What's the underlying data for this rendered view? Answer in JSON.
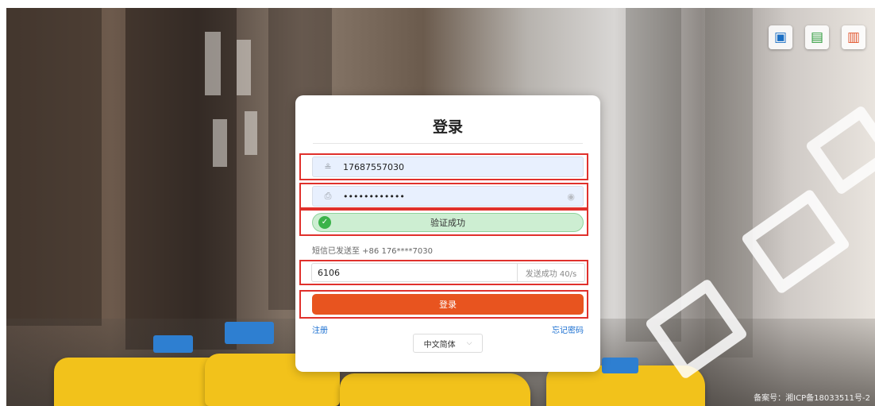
{
  "top_icons": [
    {
      "glyph": "▣",
      "name": "download-app-icon"
    },
    {
      "glyph": "▤",
      "name": "manual-icon"
    },
    {
      "glyph": "▥",
      "name": "presentation-icon"
    }
  ],
  "login": {
    "title": "登录",
    "phone_value": "17687557030",
    "password_value": "••••••••••••",
    "user_icon": "≗",
    "lock_icon": "⎙",
    "eye_icon": "◉",
    "verify_check": "✓",
    "verify_text": "验证成功",
    "sms_hint": "短信已发送至 +86 176****7030",
    "code_value": "6106",
    "send_status": "发送成功 40/s",
    "submit_label": "登录",
    "register_link": "注册",
    "forgot_link": "忘记密码",
    "language": "中文简体",
    "language_chevron": "⌵"
  },
  "footer": {
    "icp": "备案号：湘ICP备18033511号-2"
  },
  "colors": {
    "accent": "#e8541f",
    "highlight": "#e0312c",
    "success": "#3bb34a",
    "link": "#1a6fd1"
  }
}
